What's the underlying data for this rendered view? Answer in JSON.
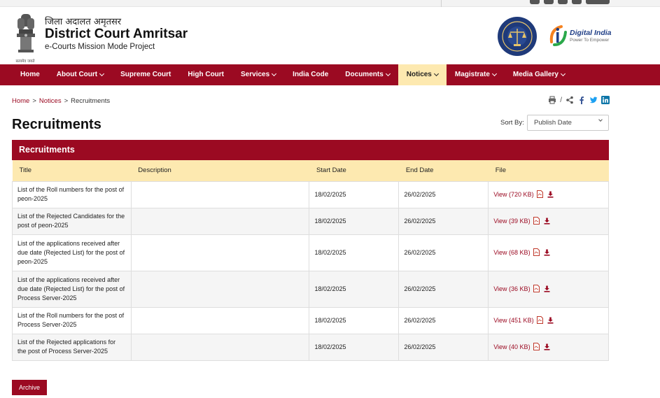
{
  "header": {
    "hindi_title": "जिला अदालत अमृतसर",
    "title": "District Court Amritsar",
    "subtitle": "e-Courts Mission Mode Project",
    "emblem_caption": "सत्यमेव जयते",
    "digital_india": {
      "title": "Digital India",
      "tagline": "Power To Empower"
    }
  },
  "nav": [
    {
      "label": "Home",
      "dropdown": false,
      "active": false
    },
    {
      "label": "About Court",
      "dropdown": true,
      "active": false
    },
    {
      "label": "Supreme Court",
      "dropdown": false,
      "active": false
    },
    {
      "label": "High Court",
      "dropdown": false,
      "active": false
    },
    {
      "label": "Services",
      "dropdown": true,
      "active": false
    },
    {
      "label": "India Code",
      "dropdown": false,
      "active": false
    },
    {
      "label": "Documents",
      "dropdown": true,
      "active": false
    },
    {
      "label": "Notices",
      "dropdown": true,
      "active": true
    },
    {
      "label": "Magistrate",
      "dropdown": true,
      "active": false
    },
    {
      "label": "Media Gallery",
      "dropdown": true,
      "active": false
    }
  ],
  "breadcrumb": {
    "items": [
      "Home",
      "Notices",
      "Recruitments"
    ],
    "separator": ">"
  },
  "share": {
    "icons": [
      "print-icon",
      "share-icon",
      "facebook-icon",
      "twitter-icon",
      "linkedin-icon"
    ],
    "divider": "/"
  },
  "page": {
    "title": "Recruitments",
    "sort_label": "Sort By:",
    "sort_value": "Publish Date",
    "panel_title": "Recruitments",
    "archive_label": "Archive"
  },
  "table": {
    "columns": [
      "Title",
      "Description",
      "Start Date",
      "End Date",
      "File"
    ],
    "rows": [
      {
        "title": "List of the Roll numbers for the post of peon-2025",
        "description": "",
        "start": "18/02/2025",
        "end": "26/02/2025",
        "file": "View (720 KB)"
      },
      {
        "title": "List of the Rejected Candidates for the post of peon-2025",
        "description": "",
        "start": "18/02/2025",
        "end": "26/02/2025",
        "file": "View (39 KB)"
      },
      {
        "title": "List of the applications received after due date (Rejected List) for the post of peon-2025",
        "description": "",
        "start": "18/02/2025",
        "end": "26/02/2025",
        "file": "View (68 KB)"
      },
      {
        "title": "List of the applications received after due date (Rejected List) for the post of Process Server-2025",
        "description": "",
        "start": "18/02/2025",
        "end": "26/02/2025",
        "file": "View (36 KB)"
      },
      {
        "title": "List of the Roll numbers for the post of Process Server-2025",
        "description": "",
        "start": "18/02/2025",
        "end": "26/02/2025",
        "file": "View (451 KB)"
      },
      {
        "title": "List of the Rejected applications for the post of Process Server-2025",
        "description": "",
        "start": "18/02/2025",
        "end": "26/02/2025",
        "file": "View (40 KB)"
      }
    ]
  },
  "colors": {
    "brand": "#9b0a22",
    "highlight": "#fde9b0"
  }
}
